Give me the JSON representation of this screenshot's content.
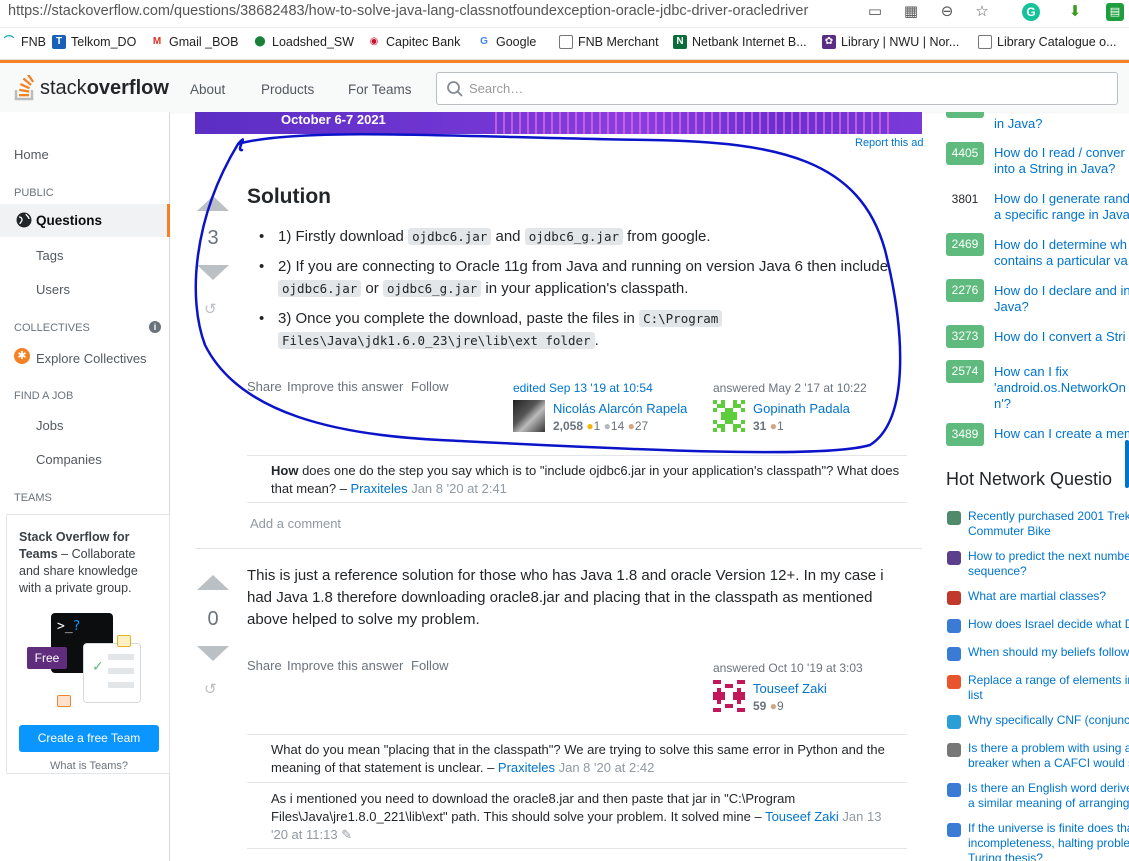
{
  "browser": {
    "url": "https://stackoverflow.com/questions/38682483/how-to-solve-java-lang-classnotfoundexception-oracle-jdbc-driver-oracledriver",
    "bookmarks": [
      "FNB",
      "Telkom_DO",
      "Gmail _BOB",
      "Loadshed_SW",
      "Capitec Bank",
      "Google",
      "FNB Merchant",
      "Netbank Internet B...",
      "Library | NWU | Nor...",
      "Library Catalogue o..."
    ]
  },
  "topbar": {
    "logo_light": "stack",
    "logo_bold": "overflow",
    "nav": [
      "About",
      "Products",
      "For Teams"
    ],
    "search_placeholder": "Search…"
  },
  "leftnav": {
    "home": "Home",
    "public": "PUBLIC",
    "questions": "Questions",
    "tags": "Tags",
    "users": "Users",
    "collectives": "COLLECTIVES",
    "explore": "Explore Collectives",
    "findjob": "FIND A JOB",
    "jobs": "Jobs",
    "companies": "Companies",
    "teams": "TEAMS",
    "teams_title": "Stack Overflow for Teams",
    "teams_desc": " – Collaborate and share knowledge with a private group.",
    "free_badge": "Free",
    "cta": "Create a free Team",
    "what_is": "What is Teams?"
  },
  "ad": {
    "date": "October 6-7 2021",
    "report": "Report this ad"
  },
  "answer1": {
    "votes": "3",
    "heading": "Solution",
    "step1_a": "1) Firstly download ",
    "step1_c1": "ojdbc6.jar",
    "step1_b": " and ",
    "step1_c2": "ojdbc6_g.jar",
    "step1_d": " from google.",
    "step2_a": "2) If you are connecting to Oracle 11g from Java and running on version Java 6 then include ",
    "step2_c1": "ojdbc6.jar",
    "step2_b": " or ",
    "step2_c2": "ojdbc6_g.jar",
    "step2_d": " in your application's classpath.",
    "step3_a": "3) Once you complete the download, paste the files in ",
    "step3_c1": "C:\\Program",
    "step3_c2": "Files\\Java\\jdk1.6.0_23\\jre\\lib\\ext folder",
    "step3_d": ".",
    "actions": [
      "Share",
      "Improve this answer",
      "Follow"
    ],
    "edited": "edited Sep 13 '19 at 10:54",
    "editor_name": "Nicolás Alarcón Rapela",
    "editor_rep": "2,058",
    "editor_gold": "1",
    "editor_silver": "14",
    "editor_bronze": "27",
    "answered": "answered May 2 '17 at 10:22",
    "author_name": "Gopinath Padala",
    "author_rep": "31",
    "author_bronze": "1",
    "comment_bold": "How",
    "comment_text": " does one do the step you say which is to \"include ojdbc6.jar in your application's classpath\"? What does that mean? – ",
    "comment_user": "Praxiteles",
    "comment_date": " Jan 8 '20 at 2:41",
    "add_comment": "Add a comment"
  },
  "answer2": {
    "votes": "0",
    "body": "This is just a reference solution for those who has Java 1.8 and oracle Version 12+. In my case i had Java 1.8 therefore downloading oracle8.jar and placing that in the classpath as mentioned above helped to solve my problem.",
    "actions": [
      "Share",
      "Improve this answer",
      "Follow"
    ],
    "answered": "answered Oct 10 '19 at 3:03",
    "author_name": "Touseef Zaki",
    "author_rep": "59",
    "author_bronze": "9",
    "c1_text": "What do you mean \"placing that in the classpath\"? We are trying to solve this same error in Python and the meaning of that statement is unclear. – ",
    "c1_user": "Praxiteles",
    "c1_date": " Jan 8 '20 at 2:42",
    "c2_text": "As i mentioned you need to download the oracle8.jar and then paste that jar in \"C:\\Program Files\\Java\\jre1.8.0_221\\lib\\ext\" path. This should solve your problem. It solved mine – ",
    "c2_user": "Touseef Zaki",
    "c2_date": " Jan 13 '20 at 11:13"
  },
  "related": [
    {
      "score": "",
      "title": "in Java?"
    },
    {
      "score": "4405",
      "title": "How do I read / conver",
      "title2": "into a String in Java?"
    },
    {
      "score": "3801",
      "title": "How do I generate rand",
      "title2": "a specific range in Java"
    },
    {
      "score": "2469",
      "title": "How do I determine wh",
      "title2": "contains a particular va"
    },
    {
      "score": "2276",
      "title": "How do I declare and in",
      "title2": "Java?"
    },
    {
      "score": "3273",
      "title": "How do I convert a Stri"
    },
    {
      "score": "2574",
      "title": "How can I fix",
      "title2": "'android.os.NetworkOn",
      "title3": "n'?"
    },
    {
      "score": "3489",
      "title": "How can I create a mem"
    }
  ],
  "hot": {
    "heading": "Hot Network Questio",
    "items": [
      {
        "t1": "Recently purchased 2001 Trek",
        "t2": "Commuter Bike",
        "color": "#4f8a6b"
      },
      {
        "t1": "How to predict the next numbe",
        "t2": "sequence?",
        "color": "#5b3f8c"
      },
      {
        "t1": "What are martial classes?",
        "color": "#c0392b"
      },
      {
        "t1": "How does Israel decide what D",
        "color": "#3a7bd5"
      },
      {
        "t1": "When should my beliefs follow",
        "color": "#3a7bd5"
      },
      {
        "t1": "Replace a range of elements in",
        "t2": "list",
        "color": "#e8542b"
      },
      {
        "t1": "Why specifically CNF (conjunct",
        "color": "#2a9fd6"
      },
      {
        "t1": "Is there a problem with using a",
        "t2": "breaker when a CAFCI would s",
        "color": "#777777"
      },
      {
        "t1": "Is there an English word derive",
        "t2": "a similar meaning of arranging",
        "color": "#3a7bd5"
      },
      {
        "t1": "If the universe is finite does tha",
        "t2": "incompleteness, halting proble",
        "t3": "Turing thesis?",
        "color": "#3a7bd5"
      }
    ]
  },
  "colors": {
    "accent": "#f48225",
    "link": "#0074cc",
    "ink_circle": "#0b14c8",
    "accepted_green": "#5eba7d",
    "cta_blue": "#0a95ff"
  }
}
